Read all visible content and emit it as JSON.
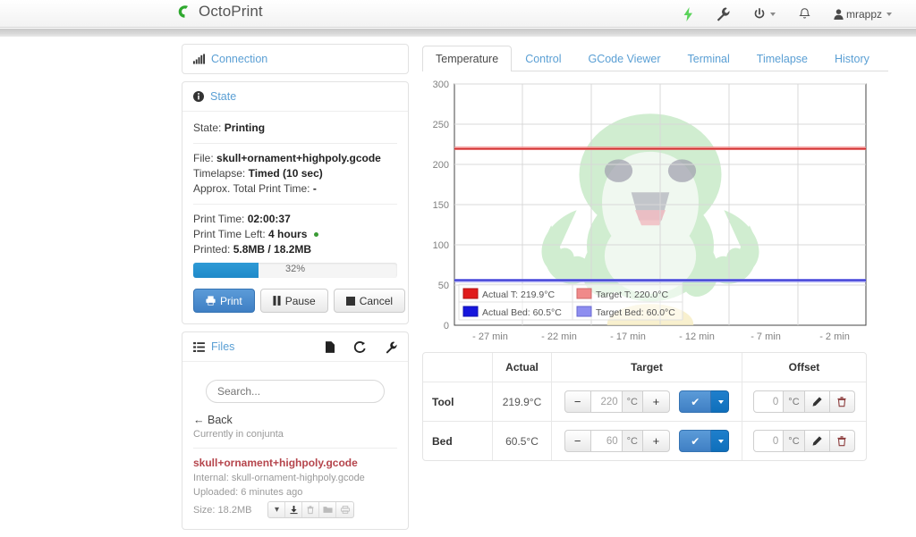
{
  "navbar": {
    "brand": "OctoPrint",
    "items": [
      {
        "name": "power-bolt-icon",
        "label": ""
      },
      {
        "name": "wrench-icon",
        "label": ""
      },
      {
        "name": "power-icon",
        "label": ""
      },
      {
        "name": "bell-icon",
        "label": ""
      }
    ],
    "user": "mrappz"
  },
  "connection": {
    "title": "Connection",
    "icon": "signal-bars-icon"
  },
  "state": {
    "title": "State",
    "icon": "info-icon",
    "state_label": "State:",
    "state_value": "Printing",
    "file_label": "File:",
    "file_value": "skull+ornament+highpoly.gcode",
    "timelapse_label": "Timelapse:",
    "timelapse_value": "Timed (10 sec)",
    "approx_label": "Approx. Total Print Time:",
    "approx_value": "-",
    "print_time_label": "Print Time:",
    "print_time_value": "02:00:37",
    "print_time_left_label": "Print Time Left:",
    "print_time_left_value": "4 hours",
    "printed_label": "Printed:",
    "printed_value": "5.8MB / 18.2MB",
    "progress_percent": 32,
    "progress_label": "32%",
    "buttons": [
      {
        "name": "print-button",
        "label": "Print",
        "icon": "printer-icon"
      },
      {
        "name": "pause-button",
        "label": "Pause",
        "icon": "pause-icon"
      },
      {
        "name": "cancel-button",
        "label": "Cancel",
        "icon": "stop-icon"
      }
    ]
  },
  "files": {
    "title": "Files",
    "icon": "list-icon",
    "head_icons": [
      "file-icon",
      "refresh-icon",
      "wrench-icon"
    ],
    "search_placeholder": "Search...",
    "back_label": "Back",
    "current_folder": "Currently in conjunta",
    "entry": {
      "name": "skull+ornament+highpoly.gcode",
      "internal_label": "Internal:",
      "internal_value": "skull-ornament-highpoly.gcode",
      "uploaded_label": "Uploaded:",
      "uploaded_value": "6 minutes ago",
      "size_label": "Size:",
      "size_value": "18.2MB",
      "actions": [
        "chevron-down-icon",
        "download-icon",
        "trash-icon",
        "folder-icon",
        "print-icon"
      ]
    }
  },
  "tabs": [
    {
      "label": "Temperature",
      "active": true
    },
    {
      "label": "Control",
      "active": false
    },
    {
      "label": "GCode Viewer",
      "active": false
    },
    {
      "label": "Terminal",
      "active": false
    },
    {
      "label": "Timelapse",
      "active": false
    },
    {
      "label": "History",
      "active": false
    }
  ],
  "chart_data": {
    "type": "line",
    "title": "",
    "xlabel": "",
    "ylabel": "",
    "ylim": [
      0,
      300
    ],
    "yticks": [
      0,
      50,
      100,
      150,
      200,
      250,
      300
    ],
    "xticks": [
      "- 27 min",
      "- 22 min",
      "- 17 min",
      "- 12 min",
      "- 7 min",
      "- 2 min"
    ],
    "grid": true,
    "legend_position": "bottom-left",
    "series": [
      {
        "name": "Actual T: 219.9°C",
        "color": "#e01b1b",
        "value": 219.9,
        "fill": true
      },
      {
        "name": "Target T: 220.0°C",
        "color": "#f08a8a",
        "value": 220.0,
        "fill": true
      },
      {
        "name": "Actual Bed: 60.5°C",
        "color": "#1616dd",
        "value": 60.5,
        "fill": true
      },
      {
        "name": "Target Bed: 60.0°C",
        "color": "#8e8ef0",
        "value": 60.0,
        "fill": true
      }
    ]
  },
  "temp_table": {
    "headers": [
      "",
      "Actual",
      "Target",
      "Offset"
    ],
    "rows": [
      {
        "label": "Tool",
        "actual": "219.9°C",
        "target_value": "220",
        "target_unit": "°C",
        "offset_value": "0",
        "offset_unit": "°C"
      },
      {
        "label": "Bed",
        "actual": "60.5°C",
        "target_value": "60",
        "target_unit": "°C",
        "offset_value": "0",
        "offset_unit": "°C"
      }
    ],
    "minus_label": "−",
    "plus_label": "+",
    "set_label": "✔",
    "edit_icon": "pencil-icon",
    "delete_icon": "trash-icon"
  },
  "colors": {
    "accent": "#5a9fd4",
    "brand_green": "#2ea82e",
    "progress": "#1f8ac9",
    "file_red": "#b5454c"
  }
}
